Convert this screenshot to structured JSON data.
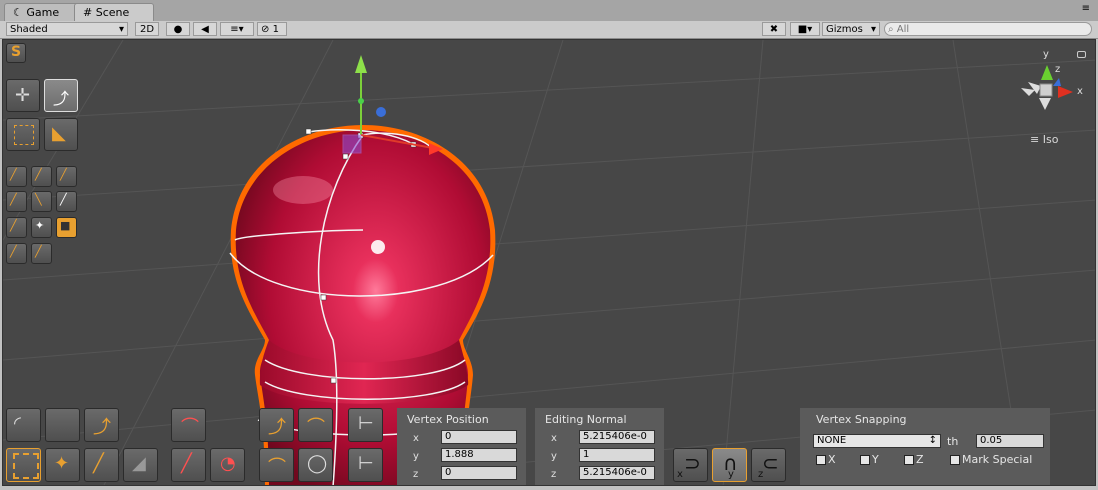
{
  "tabs": [
    {
      "label": "Game"
    },
    {
      "label": "Scene"
    }
  ],
  "toolbar": {
    "shading": "Shaded",
    "mode_2d": "2D",
    "hidden_count": "1",
    "gizmos": "Gizmos",
    "search_placeholder": "All"
  },
  "scene": {
    "view_label": "Iso",
    "gizmo_axes": {
      "x": "x",
      "y": "y",
      "z": "z"
    }
  },
  "vertex_position": {
    "title": "Vertex Position",
    "x_label": "x",
    "y_label": "y",
    "z_label": "z",
    "x": "0",
    "y": "1.888",
    "z": "0"
  },
  "editing_normal": {
    "title": "Editing Normal",
    "x_label": "x",
    "y_label": "y",
    "z_label": "z",
    "x": "5.215406e-0",
    "y": "1",
    "z": "5.215406e-0"
  },
  "vertex_snapping": {
    "title": "Vertex Snapping",
    "mode": "NONE",
    "th_label": "th",
    "threshold": "0.05",
    "x_label": "X",
    "y_label": "Y",
    "z_label": "Z",
    "mark_special_label": "Mark Special"
  },
  "axis_buttons": {
    "x": "x",
    "y": "y",
    "z": "z"
  },
  "colors": {
    "accent": "#e8a030",
    "mesh": "#c8123c",
    "outline": "#ff6a00",
    "viewport": "#474747"
  }
}
